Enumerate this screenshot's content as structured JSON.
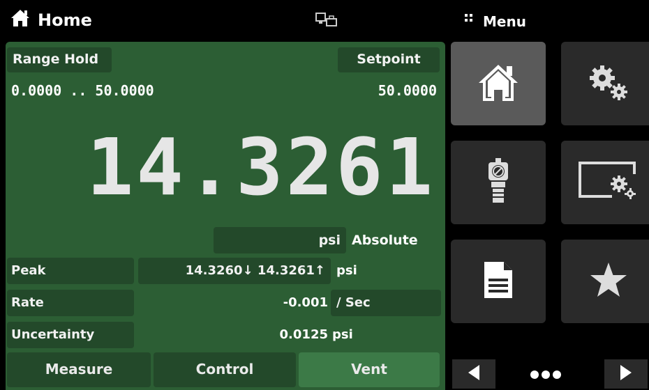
{
  "header": {
    "title": "Home",
    "home_icon": "home-icon",
    "network_icon": "network-icon",
    "menu_icon": "menu-dots-icon",
    "menu_label": "Menu"
  },
  "main": {
    "range_hold_label": "Range Hold",
    "range_value": "0.0000 .. 50.0000",
    "setpoint_label": "Setpoint",
    "setpoint_value": "50.0000",
    "reading": "14.3261",
    "unit": "psi",
    "mode": "Absolute",
    "peak": {
      "label": "Peak",
      "value": "14.3260↓ 14.3261↑",
      "unit": "psi"
    },
    "rate": {
      "label": "Rate",
      "value": "-0.001",
      "unit": "/ Sec"
    },
    "uncertainty": {
      "label": "Uncertainty",
      "value": "0.0125",
      "unit": "psi"
    }
  },
  "tabs": [
    {
      "label": "Measure"
    },
    {
      "label": "Control"
    },
    {
      "label": "Vent",
      "active": true
    }
  ],
  "menu_tiles": [
    {
      "icon": "home-icon",
      "active": true
    },
    {
      "icon": "settings-gears-icon"
    },
    {
      "icon": "sensor-icon"
    },
    {
      "icon": "display-settings-icon"
    },
    {
      "icon": "document-icon"
    },
    {
      "icon": "star-icon"
    }
  ],
  "pager": {
    "prev_icon": "left-arrow-icon",
    "dots_icon": "page-dots-icon",
    "next_icon": "right-arrow-icon"
  },
  "colors": {
    "panel_green": "#2c5e34",
    "tag_green": "#23492a",
    "active_tab": "#3c7a47",
    "tile": "#2a2a2a",
    "tile_active": "#5a5a5a"
  }
}
